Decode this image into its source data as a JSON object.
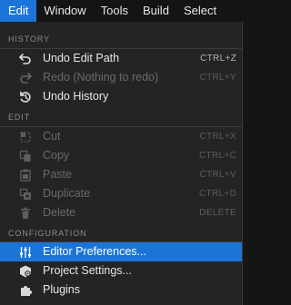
{
  "menubar": {
    "items": [
      "Edit",
      "Window",
      "Tools",
      "Build",
      "Select"
    ],
    "active_index": 0,
    "active_color": "#1b75d9"
  },
  "menu": {
    "sections": [
      {
        "title": "HISTORY",
        "items": [
          {
            "label": "Undo Edit Path",
            "shortcut": "CTRL+Z",
            "icon": "undo-icon",
            "enabled": true
          },
          {
            "label": "Redo (Nothing to redo)",
            "shortcut": "CTRL+Y",
            "icon": "redo-icon",
            "enabled": false
          },
          {
            "label": "Undo History",
            "shortcut": "",
            "icon": "undo-history-icon",
            "enabled": true
          }
        ]
      },
      {
        "title": "EDIT",
        "items": [
          {
            "label": "Cut",
            "shortcut": "CTRL+X",
            "icon": "cut-icon",
            "enabled": false
          },
          {
            "label": "Copy",
            "shortcut": "CTRL+C",
            "icon": "copy-icon",
            "enabled": false
          },
          {
            "label": "Paste",
            "shortcut": "CTRL+V",
            "icon": "paste-icon",
            "enabled": false
          },
          {
            "label": "Duplicate",
            "shortcut": "CTRL+D",
            "icon": "duplicate-icon",
            "enabled": false
          },
          {
            "label": "Delete",
            "shortcut": "DELETE",
            "icon": "delete-icon",
            "enabled": false
          }
        ]
      },
      {
        "title": "CONFIGURATION",
        "items": [
          {
            "label": "Editor Preferences...",
            "shortcut": "",
            "icon": "sliders-icon",
            "enabled": true,
            "highlighted": true
          },
          {
            "label": "Project Settings...",
            "shortcut": "",
            "icon": "project-settings-icon",
            "enabled": true
          },
          {
            "label": "Plugins",
            "shortcut": "",
            "icon": "plugin-icon",
            "enabled": true
          }
        ]
      }
    ]
  }
}
